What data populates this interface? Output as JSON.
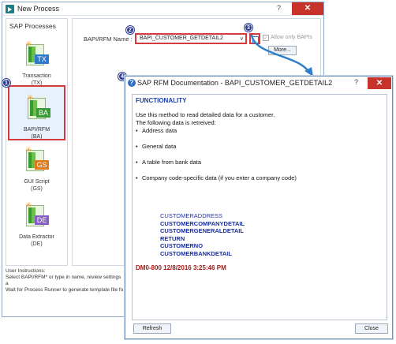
{
  "main_window": {
    "title": "New Process",
    "help": "?",
    "close": "✕"
  },
  "left_panel": {
    "heading": "SAP Processes",
    "processes": [
      {
        "badge": "TX",
        "label_line1": "Transaction",
        "label_line2": "(TX)",
        "color": "#2f79c9"
      },
      {
        "badge": "BA",
        "label_line1": "BAPI/RFM",
        "label_line2": "(BA)",
        "color": "#3b9a36"
      },
      {
        "badge": "GS",
        "label_line1": "GUI Script",
        "label_line2": "(GS)",
        "color": "#e07a1f"
      },
      {
        "badge": "DE",
        "label_line1": "Data Extractor",
        "label_line2": "(DE)",
        "color": "#8a5cc9"
      }
    ]
  },
  "form": {
    "bapi_label": "BAPI/RFM Name :",
    "bapi_value": "BAPI_CUSTOMER_GETDETAIL2",
    "allow_only_label": "Allow only BAPIs",
    "more_label": "More..."
  },
  "instructions": {
    "line1": "User Instructions:",
    "line2": "Select BAPI/RFM* or type in name, review settings a",
    "line3": "Wait for Process Runner to generate template file fo"
  },
  "markers": {
    "m1": "1",
    "m2": "2",
    "m3": "3",
    "m4": "4"
  },
  "dialog": {
    "title": "SAP RFM Documentation - BAPI_CUSTOMER_GETDETAIL2",
    "help": "?",
    "close": "✕",
    "section_title": "FUNCTIONALITY",
    "intro1": "Use this method to read detailed data for a customer.",
    "intro2": "The following data is retreived:",
    "bullets": [
      "Address data",
      "General data",
      "A table from bank data",
      "Company code-specific data (if you enter a company code)"
    ],
    "structures": [
      "CUSTOMERADDRESS",
      "CUSTOMERCOMPANYDETAIL",
      "CUSTOMERGENERALDETAIL",
      "RETURN",
      "CUSTOMERNO",
      "CUSTOMERBANKDETAIL"
    ],
    "stamp": "DM0-800 12/8/2016 3:25:46 PM",
    "refresh_label": "Refresh",
    "close_label": "Close"
  },
  "colors": {
    "highlight_red": "#d63a3a",
    "marker_blue": "#2a3b8f",
    "link_blue": "#1a3ea8",
    "close_red": "#c7322b"
  }
}
